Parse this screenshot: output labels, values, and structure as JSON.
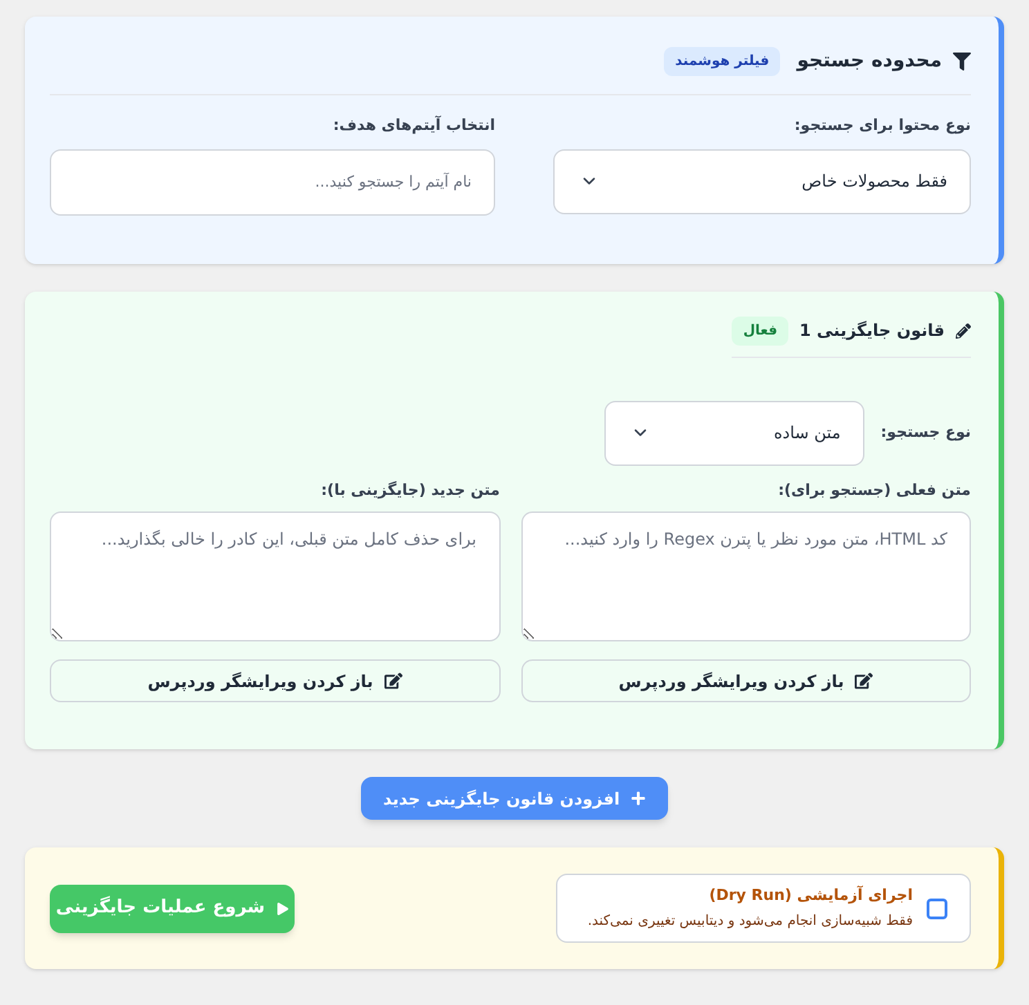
{
  "search_scope": {
    "title": "محدوده جستجو",
    "badge": "فیلتر هوشمند",
    "content_type": {
      "label": "نوع محتوا برای جستجو:",
      "value": "فقط محصولات خاص"
    },
    "target_items": {
      "label": "انتخاب آیتم‌های هدف:",
      "placeholder": "نام آیتم را جستجو کنید..."
    }
  },
  "rules": [
    {
      "title": "قانون جایگزینی 1",
      "status": "فعال",
      "search_type": {
        "label": "نوع جستجو:",
        "value": "متن ساده"
      },
      "find": {
        "label": "متن فعلی (جستجو برای):",
        "placeholder": "کد HTML، متن مورد نظر یا پترن Regex را وارد کنید...",
        "editor_button": "باز کردن ویرایشگر وردپرس"
      },
      "replace": {
        "label": "متن جدید (جایگزینی با):",
        "placeholder": "برای حذف کامل متن قبلی، این کادر را خالی بگذارید...",
        "editor_button": "باز کردن ویرایشگر وردپرس"
      }
    }
  ],
  "add_rule_button": "افزودن قانون جایگزینی جدید",
  "dry_run": {
    "title": "اجرای آزمایشی (Dry Run)",
    "description": "فقط شبیه‌سازی انجام می‌شود و دیتابیس تغییری نمی‌کند.",
    "checked": false
  },
  "start_button": "شروع عملیات جایگزینی"
}
